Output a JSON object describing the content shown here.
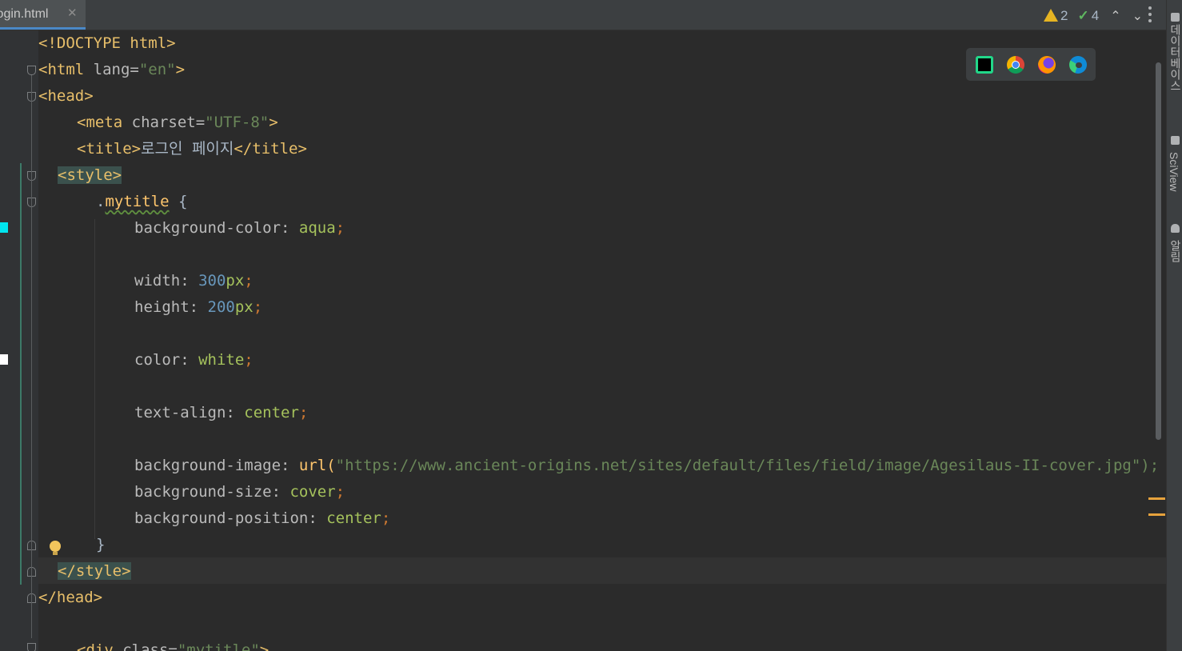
{
  "tab": {
    "filename": "login.html",
    "close_glyph": "✕"
  },
  "inspections": {
    "warnings": "2",
    "checks": "4",
    "up_glyph": "⌃",
    "down_glyph": "⌄"
  },
  "browsers": [
    "pycharm-icon",
    "chrome-icon",
    "firefox-icon",
    "edge-icon"
  ],
  "side_panel": {
    "database": "데이터베이스",
    "sciview": "SciView",
    "notifications": "알림"
  },
  "code": {
    "doctype": "<!DOCTYPE html>",
    "html_open": "<html",
    "lang_attr": " lang=",
    "lang_val": "\"en\"",
    "gt": ">",
    "head_open": "<head>",
    "meta_open": "<meta",
    "charset_attr": " charset=",
    "charset_val": "\"UTF-8\"",
    "title_open": "<title>",
    "title_text": "로그인 페이지",
    "title_close": "</title>",
    "style_open": "<style>",
    "selector_dot": ".",
    "selector_name": "mytitle",
    "brace_open": " {",
    "bgcolor_prop": "background-color: ",
    "bgcolor_val": "aqua",
    "semi": ";",
    "width_prop": "width: ",
    "width_num": "300",
    "width_unit": "px",
    "height_prop": "height: ",
    "height_num": "200",
    "height_unit": "px",
    "color_prop": "color: ",
    "color_val": "white",
    "align_prop": "text-align: ",
    "align_val": "center",
    "bgimage_prop": "background-image: ",
    "bgimage_fn": "url(",
    "bgimage_url": "\"https://www.ancient-origins.net/sites/default/files/field/image/Agesilaus-II-cover.jpg\");",
    "bgsize_prop": "background-size: ",
    "bgsize_val": "cover",
    "bgpos_prop": "background-position: ",
    "bgpos_val": "center",
    "brace_close": "}",
    "style_close": "</style>",
    "head_close": "</head>",
    "div_open": "<div",
    "class_attr": " class=",
    "class_val": "\"mytitle\""
  },
  "colors": {
    "editor_bg": "#2b2b2b",
    "tag": "#e8bf6a",
    "string": "#6a8759",
    "number": "#6897bb",
    "keyword": "#cc7832",
    "warning": "#e6b422",
    "ok": "#5fb760"
  }
}
